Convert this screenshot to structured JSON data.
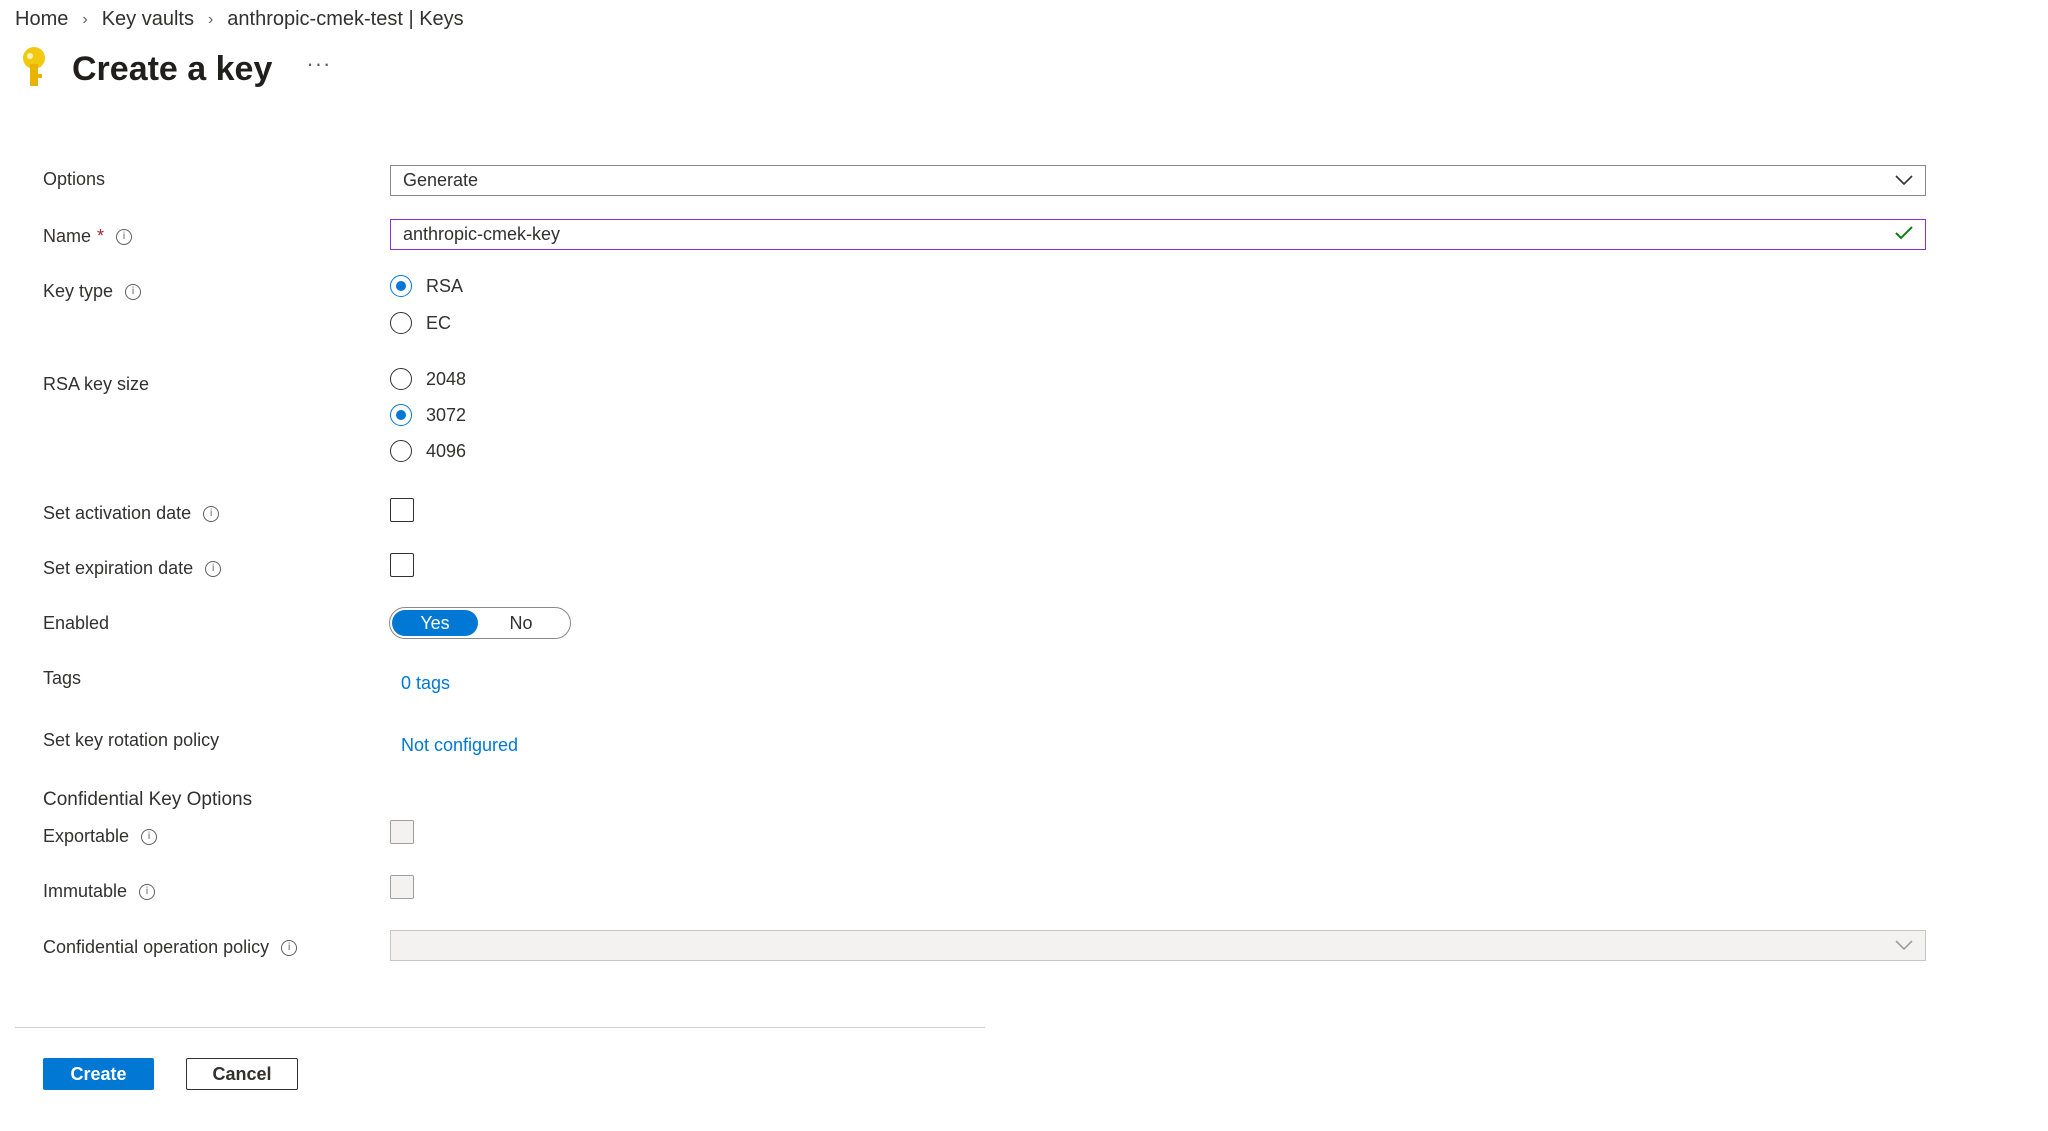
{
  "breadcrumb": {
    "home": "Home",
    "key_vaults": "Key vaults",
    "resource": "anthropic-cmek-test | Keys"
  },
  "page": {
    "title": "Create a key",
    "more": "···"
  },
  "form": {
    "options": {
      "label": "Options",
      "value": "Generate"
    },
    "name": {
      "label": "Name",
      "required": "*",
      "value": "anthropic-cmek-key"
    },
    "key_type": {
      "label": "Key type",
      "options": [
        "RSA",
        "EC"
      ],
      "selected": "RSA"
    },
    "rsa_key_size": {
      "label": "RSA key size",
      "options": [
        "2048",
        "3072",
        "4096"
      ],
      "selected": "3072"
    },
    "activation": {
      "label": "Set activation date",
      "checked": false
    },
    "expiration": {
      "label": "Set expiration date",
      "checked": false
    },
    "enabled": {
      "label": "Enabled",
      "yes": "Yes",
      "no": "No",
      "selected": "Yes"
    },
    "tags": {
      "label": "Tags",
      "link": "0 tags"
    },
    "rotation": {
      "label": "Set key rotation policy",
      "link": "Not configured"
    },
    "confidential": {
      "heading": "Confidential Key Options",
      "exportable": {
        "label": "Exportable",
        "checked": false,
        "disabled": true
      },
      "immutable": {
        "label": "Immutable",
        "checked": false,
        "disabled": true
      },
      "policy": {
        "label": "Confidential operation policy",
        "value": ""
      }
    }
  },
  "actions": {
    "create": "Create",
    "cancel": "Cancel"
  },
  "colors": {
    "accent": "#0078d4",
    "name_border": "#8a2be2",
    "valid_check": "#107c10",
    "key_icon": "#f2c811"
  }
}
